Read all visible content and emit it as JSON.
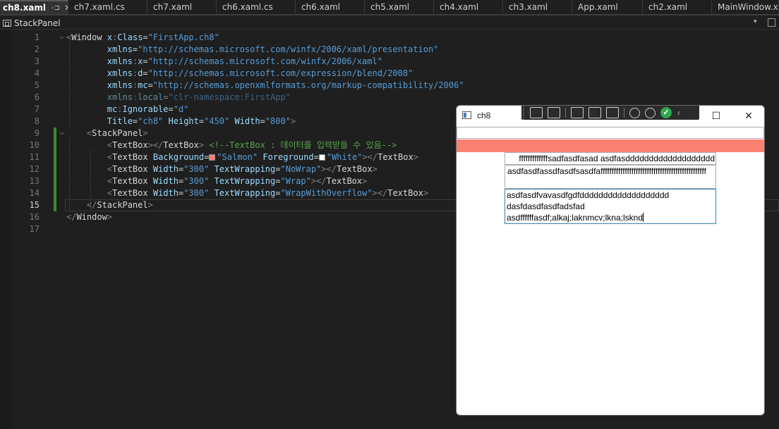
{
  "tabs": [
    {
      "label": "ch8.xaml",
      "active": true
    },
    {
      "label": "ch7.xaml.cs"
    },
    {
      "label": "ch7.xaml"
    },
    {
      "label": "ch6.xaml.cs"
    },
    {
      "label": "ch6.xaml"
    },
    {
      "label": "ch5.xaml"
    },
    {
      "label": "ch4.xaml"
    },
    {
      "label": "ch3.xaml"
    },
    {
      "label": "App.xaml"
    },
    {
      "label": "ch2.xaml"
    },
    {
      "label": "MainWindow.xaml"
    }
  ],
  "tab_buttons": {
    "pin": "-⊐",
    "close": "✕"
  },
  "navbar": {
    "label": "StackPanel",
    "dropdown": "▾"
  },
  "fold_glyph": "⌵",
  "lines": [
    {
      "n": "1",
      "tokens": [
        [
          "punc",
          "<"
        ],
        [
          "tagw",
          "Window"
        ],
        [
          "txt",
          " "
        ],
        [
          "attr",
          "x"
        ],
        [
          "ns",
          ":"
        ],
        [
          "attr",
          "Class"
        ],
        [
          "eq",
          "="
        ],
        [
          "str",
          "\"FirstApp.ch8\""
        ]
      ]
    },
    {
      "n": "2",
      "tokens": [
        [
          "txt",
          "        "
        ],
        [
          "attr",
          "xmlns"
        ],
        [
          "eq",
          "="
        ],
        [
          "str",
          "\"http://schemas.microsoft.com/winfx/2006/xaml/presentation\""
        ]
      ]
    },
    {
      "n": "3",
      "tokens": [
        [
          "txt",
          "        "
        ],
        [
          "attr",
          "xmlns"
        ],
        [
          "ns",
          ":"
        ],
        [
          "attr",
          "x"
        ],
        [
          "eq",
          "="
        ],
        [
          "str",
          "\"http://schemas.microsoft.com/winfx/2006/xaml\""
        ]
      ]
    },
    {
      "n": "4",
      "tokens": [
        [
          "txt",
          "        "
        ],
        [
          "attr",
          "xmlns"
        ],
        [
          "ns",
          ":"
        ],
        [
          "attr",
          "d"
        ],
        [
          "eq",
          "="
        ],
        [
          "str",
          "\"http://schemas.microsoft.com/expression/blend/2008\""
        ]
      ]
    },
    {
      "n": "5",
      "tokens": [
        [
          "txt",
          "        "
        ],
        [
          "attr",
          "xmlns"
        ],
        [
          "ns",
          ":"
        ],
        [
          "attr",
          "mc"
        ],
        [
          "eq",
          "="
        ],
        [
          "str",
          "\"http://schemas.openxmlformats.org/markup-compatibility/2006\""
        ]
      ]
    },
    {
      "n": "6",
      "tokens": [
        [
          "txt",
          "        "
        ],
        [
          "dim-attr",
          "xmlns"
        ],
        [
          "dim-ns",
          ":"
        ],
        [
          "dim-attr",
          "local"
        ],
        [
          "dim-eq",
          "="
        ],
        [
          "dim-str",
          "\"clr-namespace:FirstApp\""
        ]
      ]
    },
    {
      "n": "7",
      "tokens": [
        [
          "txt",
          "        "
        ],
        [
          "attr",
          "mc"
        ],
        [
          "ns",
          ":"
        ],
        [
          "attr",
          "Ignorable"
        ],
        [
          "eq",
          "="
        ],
        [
          "str",
          "\"d\""
        ]
      ]
    },
    {
      "n": "8",
      "tokens": [
        [
          "txt",
          "        "
        ],
        [
          "attr",
          "Title"
        ],
        [
          "eq",
          "="
        ],
        [
          "str",
          "\"ch8\""
        ],
        [
          "txt",
          " "
        ],
        [
          "attr",
          "Height"
        ],
        [
          "eq",
          "="
        ],
        [
          "str",
          "\"450\""
        ],
        [
          "txt",
          " "
        ],
        [
          "attr",
          "Width"
        ],
        [
          "eq",
          "="
        ],
        [
          "str",
          "\"800\""
        ],
        [
          "punc",
          ">"
        ]
      ]
    },
    {
      "n": "9",
      "tokens": [
        [
          "txt",
          "    "
        ],
        [
          "punc",
          "<"
        ],
        [
          "tagw",
          "StackPanel"
        ],
        [
          "punc",
          ">"
        ]
      ]
    },
    {
      "n": "10",
      "tokens": [
        [
          "txt",
          "        "
        ],
        [
          "punc",
          "<"
        ],
        [
          "tagw",
          "TextBox"
        ],
        [
          "punc",
          "></"
        ],
        [
          "tagw",
          "TextBox"
        ],
        [
          "punc",
          ">"
        ],
        [
          "txt",
          " "
        ],
        [
          "cmt",
          "<!--TextBox : 데이터를 입력받을 수 있음-->"
        ]
      ]
    },
    {
      "n": "11",
      "tokens": [
        [
          "txt",
          "        "
        ],
        [
          "punc",
          "<"
        ],
        [
          "tagw",
          "TextBox"
        ],
        [
          "txt",
          " "
        ],
        [
          "attr",
          "Background"
        ],
        [
          "eq",
          "="
        ],
        [
          "swatch",
          "#fa8072"
        ],
        [
          "str",
          "\"Salmon\""
        ],
        [
          "txt",
          " "
        ],
        [
          "attr",
          "Foreground"
        ],
        [
          "eq",
          "="
        ],
        [
          "swatch",
          "#ffffff"
        ],
        [
          "str",
          "\"White\""
        ],
        [
          "punc",
          "></"
        ],
        [
          "tagw",
          "TextBox"
        ],
        [
          "punc",
          ">"
        ]
      ]
    },
    {
      "n": "12",
      "tokens": [
        [
          "txt",
          "        "
        ],
        [
          "punc",
          "<"
        ],
        [
          "tagw",
          "TextBox"
        ],
        [
          "txt",
          " "
        ],
        [
          "attr",
          "Width"
        ],
        [
          "eq",
          "="
        ],
        [
          "str",
          "\"300\""
        ],
        [
          "txt",
          " "
        ],
        [
          "attr",
          "TextWrapping"
        ],
        [
          "eq",
          "="
        ],
        [
          "str",
          "\"NoWrap\""
        ],
        [
          "punc",
          "></"
        ],
        [
          "tagw",
          "TextBox"
        ],
        [
          "punc",
          ">"
        ]
      ]
    },
    {
      "n": "13",
      "tokens": [
        [
          "txt",
          "        "
        ],
        [
          "punc",
          "<"
        ],
        [
          "tagw",
          "TextBox"
        ],
        [
          "txt",
          " "
        ],
        [
          "attr",
          "Width"
        ],
        [
          "eq",
          "="
        ],
        [
          "str",
          "\"300\""
        ],
        [
          "txt",
          " "
        ],
        [
          "attr",
          "TextWrapping"
        ],
        [
          "eq",
          "="
        ],
        [
          "str",
          "\"Wrap\""
        ],
        [
          "punc",
          "></"
        ],
        [
          "tagw",
          "TextBox"
        ],
        [
          "punc",
          ">"
        ]
      ]
    },
    {
      "n": "14",
      "tokens": [
        [
          "txt",
          "        "
        ],
        [
          "punc",
          "<"
        ],
        [
          "tagw",
          "TextBox"
        ],
        [
          "txt",
          " "
        ],
        [
          "attr",
          "Width"
        ],
        [
          "eq",
          "="
        ],
        [
          "str",
          "\"300\""
        ],
        [
          "txt",
          " "
        ],
        [
          "attr",
          "TextWrapping"
        ],
        [
          "eq",
          "="
        ],
        [
          "str",
          "\"WrapWithOverflow\""
        ],
        [
          "punc",
          "></"
        ],
        [
          "tagw",
          "TextBox"
        ],
        [
          "punc",
          ">"
        ]
      ]
    },
    {
      "n": "15",
      "tokens": [
        [
          "txt",
          "    "
        ],
        [
          "punc",
          "</"
        ],
        [
          "tagw",
          "StackPanel"
        ],
        [
          "punc",
          ">"
        ]
      ],
      "current": true
    },
    {
      "n": "16",
      "tokens": [
        [
          "punc",
          "</"
        ],
        [
          "tagw",
          "Window"
        ],
        [
          "punc",
          ">"
        ]
      ]
    },
    {
      "n": "17",
      "tokens": []
    }
  ],
  "modified_lines": [
    "9",
    "10",
    "11",
    "12",
    "13",
    "14",
    "15"
  ],
  "fold_lines": [
    "1",
    "9"
  ],
  "app_window": {
    "title": "ch8",
    "minimize": "—",
    "maximize": "☐",
    "close": "✕",
    "toolbar_check": "✓",
    "toolbar_arrow": "‹",
    "textboxes": [
      {
        "text": ""
      },
      {
        "text": ""
      },
      {
        "text": "fffffffffffffsadfasdfasad asdfasddddddddddddddddddd"
      },
      {
        "text": "asdfasdfassdfasdfsasdfaffffffffffffffffffffffffffffffffffffffffffffffff"
      },
      {
        "text": "asdfasdfvavasdfgdfddddddddddddddddddd\ndasfdasdfasdfadsfad\nasdffffffasdf;alkaj;laknmcv;lkna;lsknd"
      }
    ]
  }
}
